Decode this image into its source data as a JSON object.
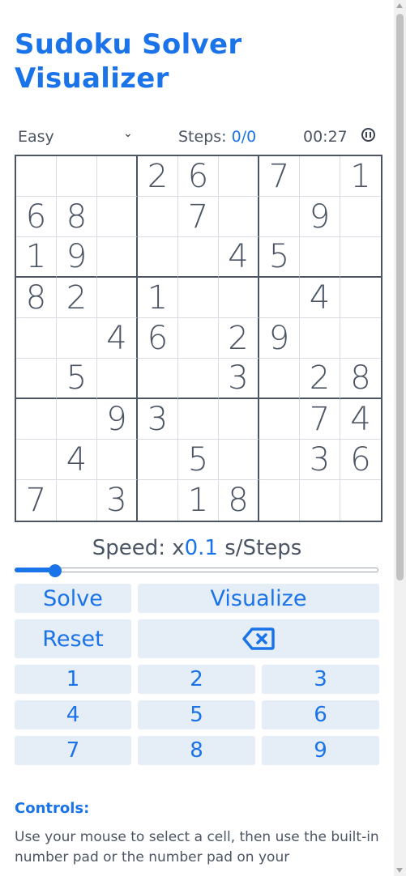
{
  "title": "Sudoku Solver Visualizer",
  "difficulty": {
    "selected": "Easy"
  },
  "steps": {
    "label": "Steps: ",
    "value": "0/0"
  },
  "timer": "00:27",
  "board": [
    [
      "",
      "",
      "",
      "2",
      "6",
      "",
      "7",
      "",
      "1"
    ],
    [
      "6",
      "8",
      "",
      "",
      "7",
      "",
      "",
      "9",
      ""
    ],
    [
      "1",
      "9",
      "",
      "",
      "",
      "4",
      "5",
      "",
      ""
    ],
    [
      "8",
      "2",
      "",
      "1",
      "",
      "",
      "",
      "4",
      ""
    ],
    [
      "",
      "",
      "4",
      "6",
      "",
      "2",
      "9",
      "",
      ""
    ],
    [
      "",
      "5",
      "",
      "",
      "",
      "3",
      "",
      "2",
      "8"
    ],
    [
      "",
      "",
      "9",
      "3",
      "",
      "",
      "",
      "7",
      "4"
    ],
    [
      "",
      "4",
      "",
      "",
      "5",
      "",
      "",
      "3",
      "6"
    ],
    [
      "7",
      "",
      "3",
      "",
      "1",
      "8",
      "",
      "",
      ""
    ]
  ],
  "speed": {
    "prefix": "Speed: x",
    "value": "0.1",
    "suffix": " s/Steps",
    "slider_fraction": 0.1
  },
  "buttons": {
    "solve": "Solve",
    "visualize": "Visualize",
    "reset": "Reset",
    "backspace_icon": "backspace-x-icon"
  },
  "numpad": [
    "1",
    "2",
    "3",
    "4",
    "5",
    "6",
    "7",
    "8",
    "9"
  ],
  "controls": {
    "title": "Controls:",
    "text": "Use your mouse to select a cell, then use the built-in number pad or the number pad on your"
  },
  "colors": {
    "accent": "#1a73e8",
    "button_bg": "#e5edf7",
    "text": "#4b5563"
  }
}
